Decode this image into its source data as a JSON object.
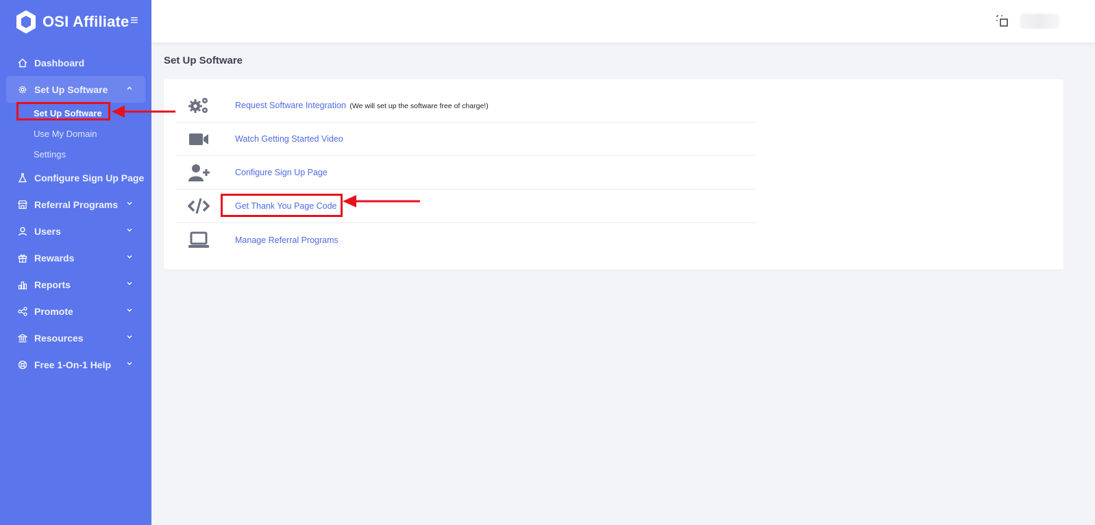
{
  "brand": {
    "name": "OSI Affiliate"
  },
  "sidebar": {
    "items": [
      {
        "label": "Dashboard",
        "icon": "home-icon"
      },
      {
        "label": "Set Up Software",
        "icon": "gear-icon",
        "expanded": true,
        "children": [
          {
            "label": "Set Up Software",
            "current": true
          },
          {
            "label": "Use My Domain"
          },
          {
            "label": "Settings"
          }
        ]
      },
      {
        "label": "Configure Sign Up Page",
        "icon": "flask-icon"
      },
      {
        "label": "Referral Programs",
        "icon": "store-icon"
      },
      {
        "label": "Users",
        "icon": "user-icon"
      },
      {
        "label": "Rewards",
        "icon": "gift-icon"
      },
      {
        "label": "Reports",
        "icon": "bar-chart-icon"
      },
      {
        "label": "Promote",
        "icon": "share-icon"
      },
      {
        "label": "Resources",
        "icon": "bank-icon"
      },
      {
        "label": "Free 1-On-1 Help",
        "icon": "lifebuoy-icon"
      }
    ]
  },
  "page": {
    "title": "Set Up Software"
  },
  "actions": [
    {
      "label": "Request Software Integration",
      "note": "(We will set up the software free of charge!)",
      "icon": "gears-icon"
    },
    {
      "label": "Watch Getting Started Video",
      "icon": "video-camera-icon"
    },
    {
      "label": "Configure Sign Up Page",
      "icon": "user-plus-icon"
    },
    {
      "label": "Get Thank You Page Code",
      "icon": "code-icon"
    },
    {
      "label": "Manage Referral Programs",
      "icon": "laptop-icon"
    }
  ],
  "colors": {
    "sidebar": "#5b75ec",
    "link": "#4e6be3",
    "annotation": "#e8101c"
  }
}
